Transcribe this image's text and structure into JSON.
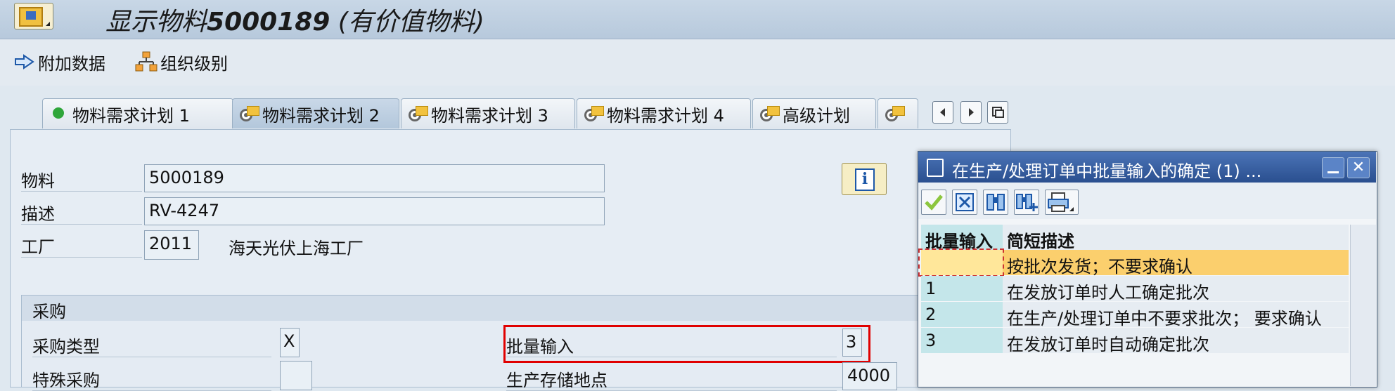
{
  "header": {
    "title_prefix": "显示物料",
    "title_material": "5000189",
    "title_suffix": " (有价值物料)"
  },
  "toolbar": {
    "additional_data": "附加数据",
    "org_levels": "组织级别"
  },
  "tabs": [
    {
      "label": "物料需求计划 1"
    },
    {
      "label": "物料需求计划 2"
    },
    {
      "label": "物料需求计划 3"
    },
    {
      "label": "物料需求计划 4"
    },
    {
      "label": "高级计划"
    }
  ],
  "form": {
    "material_label": "物料",
    "material_value": "5000189",
    "description_label": "描述",
    "description_value": "RV-4247",
    "plant_label": "工厂",
    "plant_value": "2011",
    "plant_name": "海天光伏上海工厂"
  },
  "procurement": {
    "section_title": "采购",
    "proc_type_label": "采购类型",
    "proc_type_value": "X",
    "special_proc_label": "特殊采购",
    "special_proc_value": "",
    "batch_entry_label": "批量输入",
    "batch_entry_value": "3",
    "prod_storage_label": "生产存储地点",
    "prod_storage_value": "4000"
  },
  "popup": {
    "title": "在生产/处理订单中批量输入的确定 (1) ...",
    "close_glyph": "✕",
    "columns": [
      "批量输入",
      "简短描述"
    ],
    "rows": [
      {
        "key": "",
        "desc": "按批次发货；不要求确认"
      },
      {
        "key": "1",
        "desc": "在发放订单时人工确定批次"
      },
      {
        "key": "2",
        "desc": "在生产/处理订单中不要求批次； 要求确认"
      },
      {
        "key": "3",
        "desc": "在发放订单时自动确定批次"
      }
    ]
  },
  "colors": {
    "highlight": "#e00000",
    "selected_row": "#fbcf6d",
    "popup_title": "#2a4f8f"
  }
}
